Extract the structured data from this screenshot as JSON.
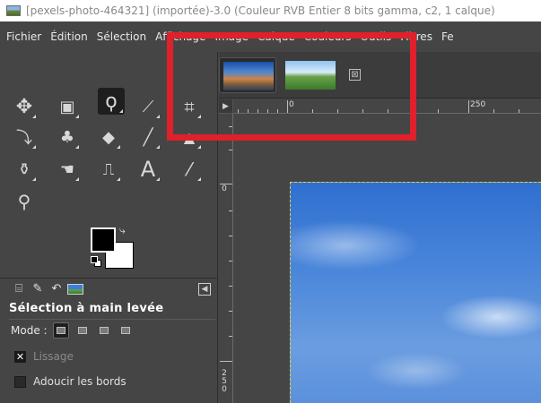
{
  "window": {
    "title": "[pexels-photo-464321] (importée)-3.0 (Couleur RVB Entier 8 bits gamma, c2, 1 calque)"
  },
  "menu": {
    "items": [
      "Fichier",
      "Édition",
      "Sélection",
      "Affichage",
      "Image",
      "Calque",
      "Couleurs",
      "Outils",
      "Filtres",
      "Fe"
    ]
  },
  "tools": {
    "move": "✥",
    "rect_select": "▣",
    "free_select": "ϙ",
    "fuzzy_select": "⟋",
    "crop": "⌗",
    "warp": "⤵",
    "clone": "♣",
    "fill": "◆",
    "paint": "╱",
    "eraser": "▲",
    "heal": "⚱",
    "smudge": "☚",
    "path": "⎍",
    "text": "A",
    "color_picker": "⁄",
    "zoom": "⚲"
  },
  "tool_options": {
    "title": "Sélection à main levée",
    "mode_label": "Mode :",
    "smooth_label": "Lissage",
    "smooth_checked": "✕",
    "feather_label": "Adoucir les bords"
  },
  "image_tabs": {
    "close": "⊠"
  },
  "rulers": {
    "corner": "▶",
    "h_labels": [
      "0",
      "250"
    ],
    "v_labels": [
      "0",
      "2",
      "5",
      "0"
    ]
  },
  "colors": {
    "foreground": "#000000",
    "background": "#ffffff",
    "highlight": "#e0202a",
    "selection_marching": "#e8d028"
  }
}
